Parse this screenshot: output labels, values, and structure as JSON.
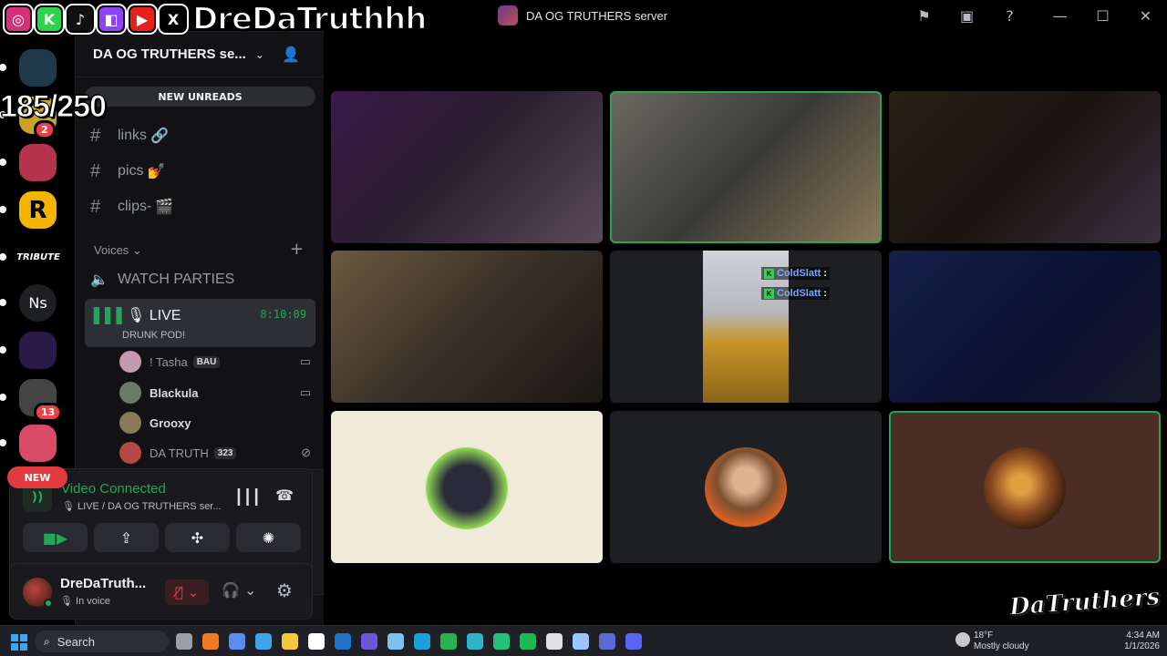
{
  "overlay": {
    "socials": [
      {
        "icon": "instagram-icon",
        "glyph": "◎",
        "color": "#d6307a"
      },
      {
        "icon": "kick-icon",
        "glyph": "K",
        "color": "#2bd44a"
      },
      {
        "icon": "tiktok-icon",
        "glyph": "♪",
        "color": "#111111"
      },
      {
        "icon": "twitch-icon",
        "glyph": "◧",
        "color": "#8b44f7"
      },
      {
        "icon": "youtube-icon",
        "glyph": "▶",
        "color": "#e62117"
      },
      {
        "icon": "x-icon",
        "glyph": "X",
        "color": "#000000"
      }
    ],
    "handle": "DreDaTruthhh",
    "counter": "185/250",
    "watermark": "DaTruthers"
  },
  "titlebar": {
    "title": "DA OG TRUTHERS server",
    "buttons": [
      "flag-icon",
      "inbox-icon",
      "help-icon",
      "minimize-icon",
      "maximize-icon",
      "close-icon"
    ]
  },
  "rail": {
    "servers": [
      {
        "name": "party-server",
        "label": "",
        "bg": "#1e3a4a"
      },
      {
        "name": "server-2",
        "label": "",
        "bg": "#c9a227",
        "mention": "2"
      },
      {
        "name": "server-3",
        "label": "",
        "bg": "#b5334d"
      },
      {
        "name": "rockstar-server",
        "label": "R",
        "bg": "#f5b400"
      },
      {
        "name": "tribute-server",
        "label": "TRIBUTE",
        "bg": "#000000"
      },
      {
        "name": "ns-server",
        "label": "Ns",
        "bg": "#1e1f22"
      },
      {
        "name": "server-7",
        "label": "",
        "bg": "#2a1a4a"
      },
      {
        "name": "server-8",
        "label": "",
        "bg": "#444444",
        "mention": "13"
      },
      {
        "name": "server-9",
        "label": "",
        "bg": "#d94a66"
      }
    ],
    "new_label": "NEW"
  },
  "sidebar": {
    "server_name": "DA OG TRUTHERS se...",
    "new_unreads": "NEW UNREADS",
    "text_channels": [
      {
        "name": "links",
        "emoji": "🔗"
      },
      {
        "name": "pics",
        "emoji": "💅"
      },
      {
        "name": "clips-",
        "emoji": "🎬"
      }
    ],
    "voice_category": "Voices",
    "watch_parties": "WATCH PARTIES",
    "live_channel": {
      "name": "LIVE",
      "timer": "8:10:09",
      "subtitle": "DRUNK POD!"
    },
    "members": [
      {
        "name": "! Tasha",
        "tag": "BAU",
        "right": "▭",
        "color": "#c59ab0"
      },
      {
        "name": "Blackula",
        "tag": "",
        "right": "▭",
        "color": "#6a7a6a"
      },
      {
        "name": "Grooxy",
        "tag": "",
        "right": "",
        "color": "#8a7a5a"
      },
      {
        "name": "DA TRUTH",
        "tag": "323",
        "right": "⊘",
        "color": "#b84848"
      }
    ]
  },
  "voice_panel": {
    "status": "Video Connected",
    "location": "LIVE / DA OG TRUTHERS ser...",
    "buttons": [
      "camera-button",
      "screen-share-button",
      "activities-button",
      "soundboard-button"
    ]
  },
  "user_bar": {
    "name": "DreDaTruth...",
    "status": "In voice"
  },
  "chat_overlay": [
    {
      "user": "ColdSlatt",
      "suffix": ":"
    },
    {
      "user": "ColdSlatt",
      "suffix": ":"
    }
  ],
  "tiles": [
    {
      "name": "video-tile-1",
      "bg": "linear-gradient(135deg,#3a1a4a 0%,#2a1d2e 45%,#5a4a5a 100%)",
      "speaking": false,
      "kind": "video"
    },
    {
      "name": "video-tile-2",
      "bg": "linear-gradient(135deg,#6a6a60 0%,#3a3a36 50%,#8a7a5a 100%)",
      "speaking": true,
      "kind": "video"
    },
    {
      "name": "video-tile-3",
      "bg": "linear-gradient(135deg,#2a2016 0%,#1a1510 50%,#3a3040 100%)",
      "speaking": false,
      "kind": "video"
    },
    {
      "name": "video-tile-4",
      "bg": "linear-gradient(135deg,#6a5a40 0%,#3a3028 50%,#1a1812 100%)",
      "speaking": false,
      "kind": "video"
    },
    {
      "name": "video-tile-5",
      "bg": "#1e1f22",
      "speaking": false,
      "kind": "portrait"
    },
    {
      "name": "video-tile-6",
      "bg": "linear-gradient(135deg,#16204a 0%,#0a1030 60%,#1a1a2a 100%)",
      "speaking": false,
      "kind": "video"
    },
    {
      "name": "avatar-tile-7",
      "bg": "#f0ebd8",
      "speaking": false,
      "kind": "avatar",
      "avatar_bg": "radial-gradient(circle,#2a2a3a 40%,#9ae65a 72%,#f0ebd8 74%)"
    },
    {
      "name": "avatar-tile-8",
      "bg": "#1e1f22",
      "speaking": false,
      "kind": "avatar",
      "avatar_bg": "radial-gradient(circle at 50% 40%,#e0b090 20%,#7a5030 45%,#e06020 72%,#1e1f22 74%)"
    },
    {
      "name": "avatar-tile-9",
      "bg": "#4a2e26",
      "speaking": true,
      "kind": "avatar",
      "avatar_bg": "radial-gradient(circle at 45% 45%,#e0a040 15%,#8a4a20 45%,#3a2010 72%,#4a2e26 74%)"
    }
  ],
  "taskbar": {
    "search": "Search",
    "apps": [
      "#9aa0a6",
      "#f07b22",
      "#5b8cf7",
      "#3ba7e8",
      "#f2c83c",
      "#ffffff",
      "#1e73c8",
      "#6b56d6",
      "#7dc3f0",
      "#1aa0d8",
      "#2bb24c",
      "#2fb5c7",
      "#27c07a",
      "#1db954",
      "#e0e0e0",
      "#9cc5ff",
      "#5a6ad8",
      "#5865f2"
    ],
    "weather_temp": "18°F",
    "weather_desc": "Mostly cloudy",
    "time": "4:34 AM",
    "date": "1/1/2026"
  }
}
